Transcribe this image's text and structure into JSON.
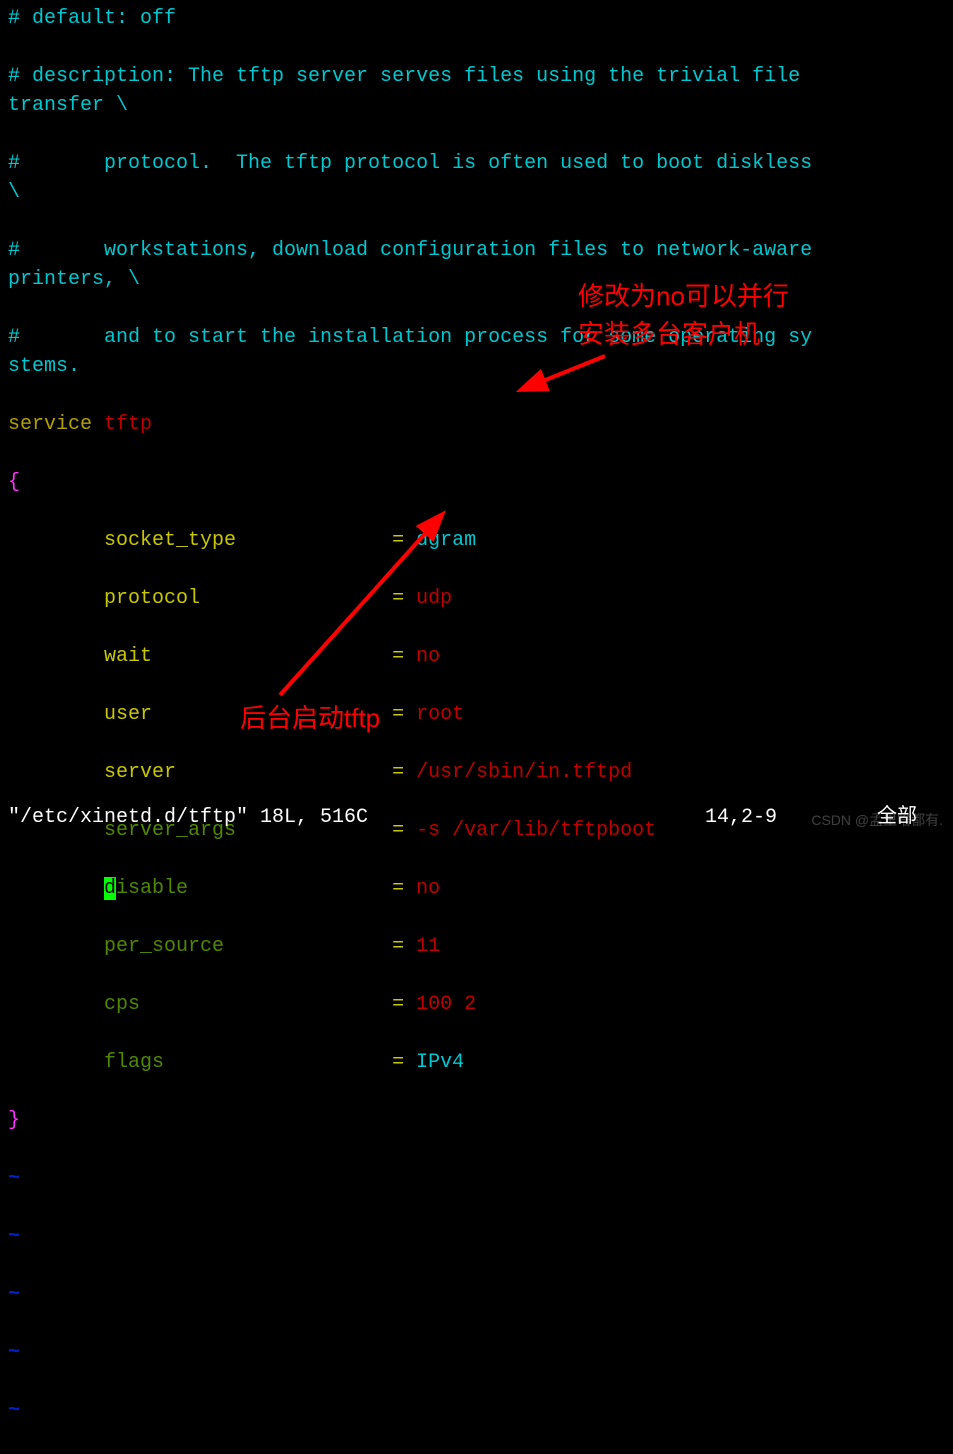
{
  "comments": {
    "l1": "# default: off",
    "l2a": "# description: The tftp server serves files using the trivial file ",
    "l2b": "transfer \\",
    "l3a": "#       protocol.  The tftp protocol is often used to boot diskless ",
    "l3b": "\\",
    "l4a": "#       workstations, download configuration files to network-aware ",
    "l4b": "printers, \\",
    "l5a": "#       and to start the installation process for some operating sy",
    "l5b": "stems."
  },
  "service_kw": "service",
  "service_name": "tftp",
  "brace_open": "{",
  "brace_close": "}",
  "config": {
    "socket_type": {
      "key": "socket_type",
      "eq": "=",
      "val": "dgram"
    },
    "protocol": {
      "key": "protocol",
      "eq": "=",
      "val": "udp"
    },
    "wait": {
      "key": "wait",
      "eq": "=",
      "val": "no"
    },
    "user": {
      "key": "user",
      "eq": "=",
      "val": "root"
    },
    "server": {
      "key": "server",
      "eq": "=",
      "val": "/usr/sbin/in.tftpd"
    },
    "server_args": {
      "key": "server_args",
      "eq": "=",
      "val": "-s /var/lib/tftpboot"
    },
    "disable": {
      "key_d": "d",
      "key_rest": "isable",
      "eq": "=",
      "val": "no"
    },
    "per_source": {
      "key": "per_source",
      "eq": "=",
      "val": "11"
    },
    "cps": {
      "key": "cps",
      "eq": "=",
      "val": "100 2"
    },
    "flags": {
      "key": "flags",
      "eq": "=",
      "val": "IPv4"
    }
  },
  "tilde": "~",
  "status": {
    "file": "\"/etc/xinetd.d/tftp\" 18L, 516C",
    "pos": "14,2-9",
    "tail": "全部"
  },
  "annotations": {
    "top1": "修改为no可以并行",
    "top2": "安装多台客户机",
    "bottom": "后台启动tftp"
  },
  "watermark": "CSDN @孟里啥都有."
}
